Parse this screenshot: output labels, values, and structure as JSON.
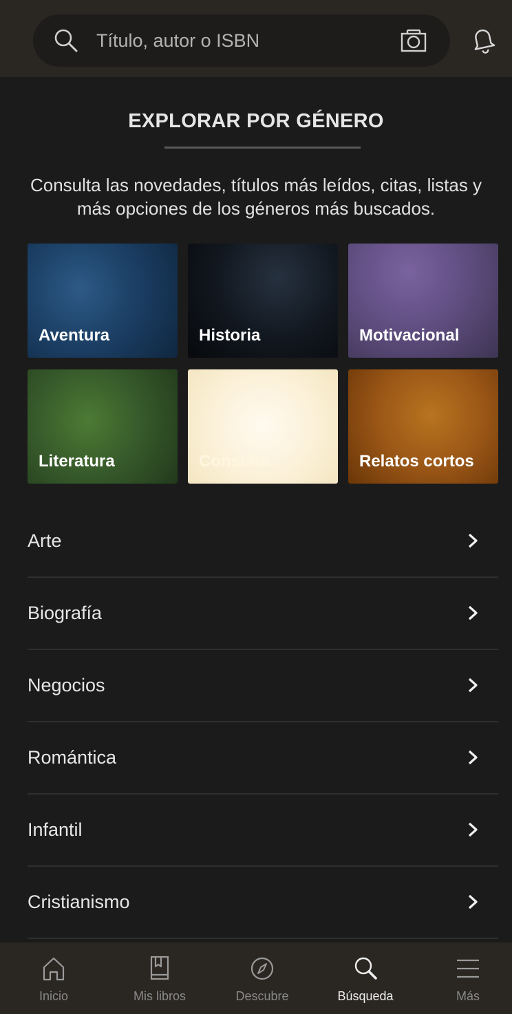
{
  "header": {
    "search_placeholder": "Título, autor o ISBN"
  },
  "intro": {
    "title": "EXPLORAR POR GÉNERO",
    "description": "Consulta las novedades, títulos más leídos, citas, listas y más opciones de los géneros más buscados."
  },
  "genre_tiles": [
    {
      "label": "Aventura",
      "color": "#1c4066"
    },
    {
      "label": "Historia",
      "color": "#0d1117"
    },
    {
      "label": "Motivacional",
      "color": "#5e4c7e"
    },
    {
      "label": "Literatura",
      "color": "#36592a"
    },
    {
      "label": "Consulta",
      "color": "#fbf0d6"
    },
    {
      "label": "Relatos cortos",
      "color": "#9a5616"
    }
  ],
  "genre_list": [
    {
      "label": "Arte"
    },
    {
      "label": "Biografía"
    },
    {
      "label": "Negocios"
    },
    {
      "label": "Romántica"
    },
    {
      "label": "Infantil"
    },
    {
      "label": "Cristianismo"
    }
  ],
  "bottom_nav": [
    {
      "label": "Inicio",
      "icon": "home-icon",
      "active": false
    },
    {
      "label": "Mis libros",
      "icon": "book-icon",
      "active": false
    },
    {
      "label": "Descubre",
      "icon": "compass-icon",
      "active": false
    },
    {
      "label": "Búsqueda",
      "icon": "search-icon",
      "active": true
    },
    {
      "label": "Más",
      "icon": "menu-icon",
      "active": false
    }
  ],
  "colors": {
    "background": "#1b1b1b",
    "header": "#2a2723",
    "nav_inactive": "#8a8a8a",
    "nav_active": "#f0f0f0"
  }
}
